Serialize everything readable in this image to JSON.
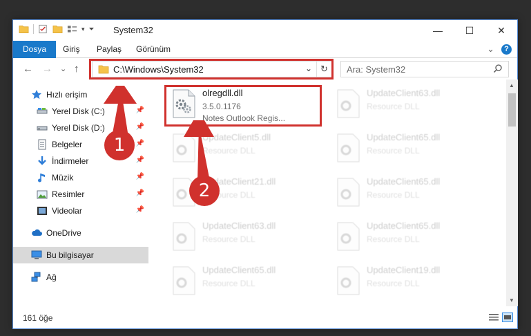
{
  "window": {
    "title": "System32",
    "controls": {
      "minimize": "—",
      "maximize": "☐",
      "close": "✕"
    }
  },
  "ribbon": {
    "tabs": [
      "Dosya",
      "Giriş",
      "Paylaş",
      "Görünüm"
    ],
    "expand": "⌄",
    "help": "?"
  },
  "nav": {
    "back": "←",
    "forward": "→",
    "recent": "⌄",
    "up": "↑",
    "address": "C:\\Windows\\System32",
    "address_dropdown": "⌄",
    "refresh": "↻",
    "search_placeholder": "Ara: System32"
  },
  "sidebar": {
    "items": [
      {
        "label": "Hızlı erişim",
        "icon": "star-icon",
        "pinned": false
      },
      {
        "label": "Yerel Disk (C:)",
        "icon": "drive-icon",
        "pinned": true
      },
      {
        "label": "Yerel Disk (D:)",
        "icon": "drive-icon",
        "pinned": true
      },
      {
        "label": "Belgeler",
        "icon": "documents-icon",
        "pinned": true
      },
      {
        "label": "İndirmeler",
        "icon": "download-icon",
        "pinned": true
      },
      {
        "label": "Müzik",
        "icon": "music-icon",
        "pinned": true
      },
      {
        "label": "Resimler",
        "icon": "pictures-icon",
        "pinned": true
      },
      {
        "label": "Videolar",
        "icon": "videos-icon",
        "pinned": true
      },
      {
        "label": "OneDrive",
        "icon": "cloud-icon",
        "pinned": false
      },
      {
        "label": "Bu bilgisayar",
        "icon": "computer-icon",
        "pinned": false,
        "selected": true
      },
      {
        "label": "Ağ",
        "icon": "network-icon",
        "pinned": false
      }
    ],
    "pin_glyph": "📌"
  },
  "files": {
    "highlighted": {
      "name": "olregdll.dll",
      "version": "3.5.0.1176",
      "description": "Notes Outlook Regis..."
    },
    "others": [
      {
        "name": "UpdateClient63.dll",
        "type": "Resource DLL"
      },
      {
        "name": "UpdateClient5.dll",
        "type": "Resource DLL"
      },
      {
        "name": "UpdateClient65.dll",
        "type": "Resource DLL"
      },
      {
        "name": "UpdateClient21.dll",
        "type": "Resource DLL"
      },
      {
        "name": "UpdateClient65.dll",
        "type": "Resource DLL"
      },
      {
        "name": "UpdateClient63.dll",
        "type": "Resource DLL"
      },
      {
        "name": "UpdateClient65.dll",
        "type": "Resource DLL"
      },
      {
        "name": "UpdateClient65.dll",
        "type": "Resource DLL"
      },
      {
        "name": "UpdateClient19.dll",
        "type": "Resource DLL"
      }
    ]
  },
  "status": {
    "count": "161 öğe"
  },
  "annotations": {
    "step1": "1",
    "step2": "2",
    "color": "#d0312d"
  },
  "colors": {
    "accent": "#1979ca",
    "highlight": "#d0312d"
  }
}
